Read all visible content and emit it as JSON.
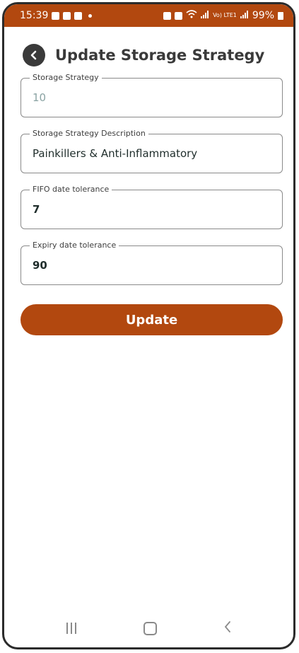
{
  "statusbar": {
    "time": "15:39",
    "network": "Vo) LTE1",
    "battery": "99%"
  },
  "header": {
    "title": "Update Storage Strategy"
  },
  "form": {
    "storage_strategy": {
      "label": "Storage Strategy",
      "value": "10"
    },
    "description": {
      "label": "Storage Strategy Description",
      "value": "Painkillers & Anti-Inflammatory"
    },
    "fifo": {
      "label": "FIFO date tolerance",
      "value": "7"
    },
    "expiry": {
      "label": "Expiry date tolerance",
      "value": "90"
    }
  },
  "actions": {
    "update_label": "Update"
  },
  "colors": {
    "accent": "#b2480f",
    "text": "#3a3a3a"
  }
}
